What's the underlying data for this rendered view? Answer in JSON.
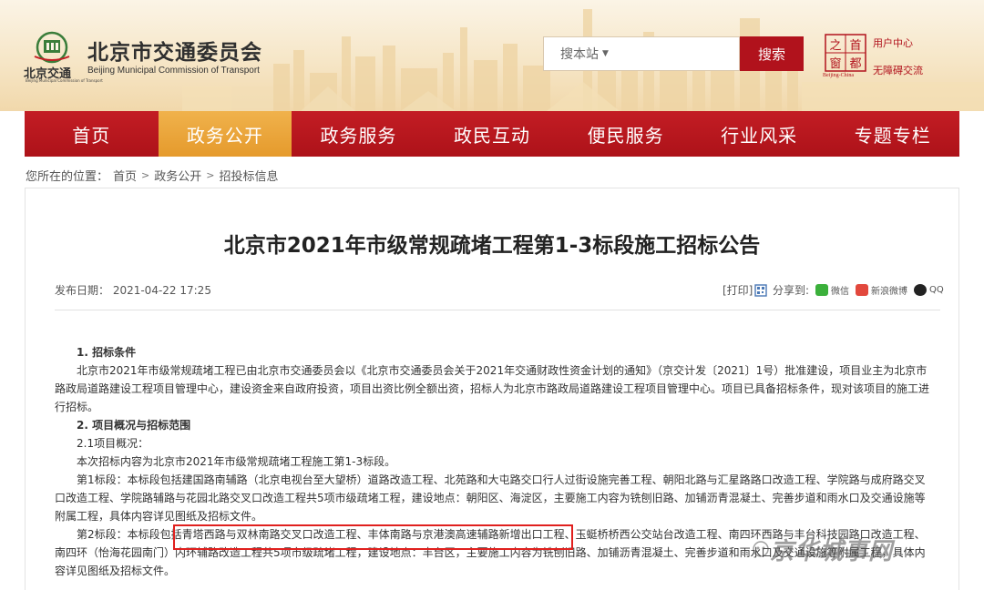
{
  "header": {
    "logo_small_text": "北京交通",
    "logo_small_en": "Beijing Municipal Commission of Transport",
    "site_title": "北京市交通委员会",
    "site_subtitle": "Beijing Municipal Commission of Transport",
    "search_placeholder": "搜本站",
    "search_button": "搜索",
    "capital_logo_en": "Beijing-China",
    "capital_logo_chars": [
      "之",
      "首",
      "窗",
      "都"
    ],
    "user_center": "用户中心",
    "accessible": "无障碍交流"
  },
  "nav": {
    "items": [
      "首页",
      "政务公开",
      "政务服务",
      "政民互动",
      "便民服务",
      "行业风采",
      "专题专栏"
    ],
    "active_index": 1
  },
  "breadcrumb": {
    "prefix": "您所在的位置：",
    "items": [
      "首页",
      "政务公开",
      "招投标信息"
    ],
    "separator": ">"
  },
  "article": {
    "title": "北京市2021年市级常规疏堵工程第1-3标段施工招标公告",
    "pubdate": "发布日期： 2021-04-22 17:25",
    "print": "[打印]",
    "share_label": "分享到:",
    "share_wechat": "微信",
    "share_weibo": "新浪微博",
    "share_qq": "QQ",
    "s1_heading": "1. 招标条件",
    "s1_body": "北京市2021年市级常规疏堵工程已由北京市交通委员会以《北京市交通委员会关于2021年交通财政性资金计划的通知》（京交计发〔2021〕1号）批准建设，项目业主为北京市路政局道路建设工程项目管理中心，建设资金来自政府投资，项目出资比例全额出资，招标人为北京市路政局道路建设工程项目管理中心。项目已具备招标条件，现对该项目的施工进行招标。",
    "s2_heading": "2. 项目概况与招标范围",
    "s21_heading": "2.1项目概况：",
    "s21_body": "本次招标内容为北京市2021年市级常规疏堵工程施工第1-3标段。",
    "lot1": "第1标段：本标段包括建国路南辅路（北京电视台至大望桥）道路改造工程、北苑路和大屯路交口行人过街设施完善工程、朝阳北路与汇星路路口改造工程、学院路与成府路交叉口改造工程、学院路辅路与花园北路交叉口改造工程共5项市级疏堵工程，建设地点：朝阳区、海淀区，主要施工内容为铣刨旧路、加铺沥青混凝土、完善步道和雨水口及交通设施等附属工程，具体内容详见图纸及招标文件。",
    "lot2": "第2标段：本标段包括青塔西路与双林南路交叉口改造工程、丰体南路与京港澳高速辅路新增出口工程、玉蜓桥桥西公交站台改造工程、南四环西路与丰台科技园路口改造工程、南四环（怡海花园南门）内环辅路改造工程共5项市级疏堵工程，建设地点：丰台区，主要施工内容为铣刨旧路、加铺沥青混凝土、完善步道和雨水口及交通设施等附属工程，具体内容详见图纸及招标文件。"
  },
  "watermark": "京华城事网",
  "colors": {
    "brand_red": "#b1121c",
    "nav_active": "#e8a33a",
    "highlight": "#e0201e"
  }
}
